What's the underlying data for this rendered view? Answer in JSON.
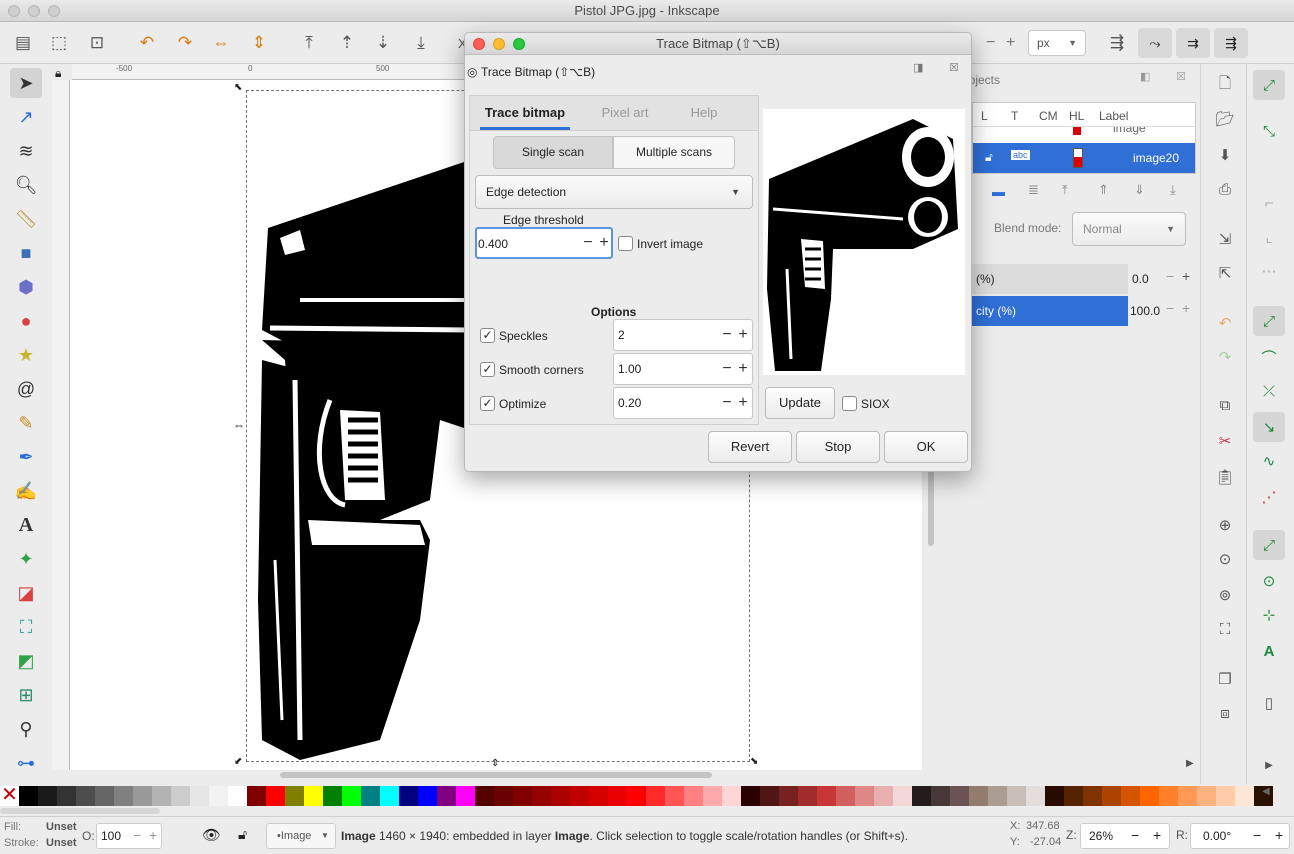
{
  "window": {
    "title": "Pistol JPG.jpg - Inkscape"
  },
  "toolbar": {
    "x_label": "X",
    "unit": "px",
    "minus": "−",
    "plus": "+"
  },
  "ruler": {
    "tick_neg500": "-500",
    "tick_0": "0",
    "tick_500": "500"
  },
  "objects_panel": {
    "title": "Objects",
    "columns": [
      "L",
      "T",
      "CM",
      "HL",
      "Label"
    ],
    "rows": [
      {
        "label": "image",
        "selected": false
      },
      {
        "label": "image20",
        "selected": true
      }
    ],
    "blend_label": "Blend mode:",
    "blend_value": "Normal",
    "blur_label": "(%)",
    "blur_value": "0.0",
    "opacity_label": "city (%)",
    "opacity_value": "100.0"
  },
  "dialog": {
    "window_title": "Trace Bitmap (⇧⌥B)",
    "panel_title": "Trace Bitmap (⇧⌥B)",
    "tabs": [
      "Trace bitmap",
      "Pixel art",
      "Help"
    ],
    "scan_modes": [
      "Single scan",
      "Multiple scans"
    ],
    "mode_value": "Edge detection",
    "threshold_label": "Edge threshold",
    "threshold_value": "0.400",
    "invert_label": "Invert image",
    "options_label": "Options",
    "speckles_label": "Speckles",
    "speckles_value": "2",
    "smooth_label": "Smooth corners",
    "smooth_value": "1.00",
    "optimize_label": "Optimize",
    "optimize_value": "0.20",
    "update_label": "Update",
    "siox_label": "SIOX",
    "revert_label": "Revert",
    "stop_label": "Stop",
    "ok_label": "OK",
    "minus": "−",
    "plus": "+",
    "check": "✓"
  },
  "palette": {
    "colors": [
      "#000000",
      "#1a1a1a",
      "#333333",
      "#4d4d4d",
      "#666666",
      "#808080",
      "#999999",
      "#b3b3b3",
      "#cccccc",
      "#e6e6e6",
      "#f2f2f2",
      "#ffffff",
      "#800000",
      "#ff0000",
      "#808000",
      "#ffff00",
      "#008000",
      "#00ff00",
      "#008080",
      "#00ffff",
      "#000080",
      "#0000ff",
      "#800080",
      "#ff00ff",
      "#550000",
      "#6b0000",
      "#800000",
      "#950000",
      "#aa0000",
      "#c00000",
      "#d40000",
      "#ea0000",
      "#ff0000",
      "#ff2a2a",
      "#ff5555",
      "#ff8080",
      "#ffaaaa",
      "#ffd5d5",
      "#2b0000",
      "#501616",
      "#782121",
      "#a02c2c",
      "#c83737",
      "#d35f5f",
      "#de8787",
      "#e9afaf",
      "#f4d7d7",
      "#241c1c",
      "#483737",
      "#6c5353",
      "#917c6f",
      "#ac9d93",
      "#c8beb7",
      "#e3dedb",
      "#280b00",
      "#552200",
      "#803300",
      "#aa4400",
      "#d45500",
      "#ff6600",
      "#ff7f2a",
      "#ff9955",
      "#ffb380",
      "#ffccaa",
      "#ffe6d5",
      "#2b1100"
    ]
  },
  "status": {
    "fill_label": "Fill:",
    "fill_value": "Unset",
    "stroke_label": "Stroke:",
    "stroke_value": "Unset",
    "opacity_label": "O:",
    "opacity_value": "100",
    "layer_value": "•Image",
    "message_bold": "Image",
    "message": " 1460 × 1940: embedded in layer ",
    "message_layer": "Image",
    "message_tail": ". Click selection to toggle scale/rotation handles (or Shift+s).",
    "x_label": "X:",
    "x_value": "347.68",
    "y_label": "Y:",
    "y_value": "-27.04",
    "z_label": "Z:",
    "zoom_value": "26%",
    "r_label": "R:",
    "rotation_value": "0.00°",
    "minus": "−",
    "plus": "+"
  }
}
